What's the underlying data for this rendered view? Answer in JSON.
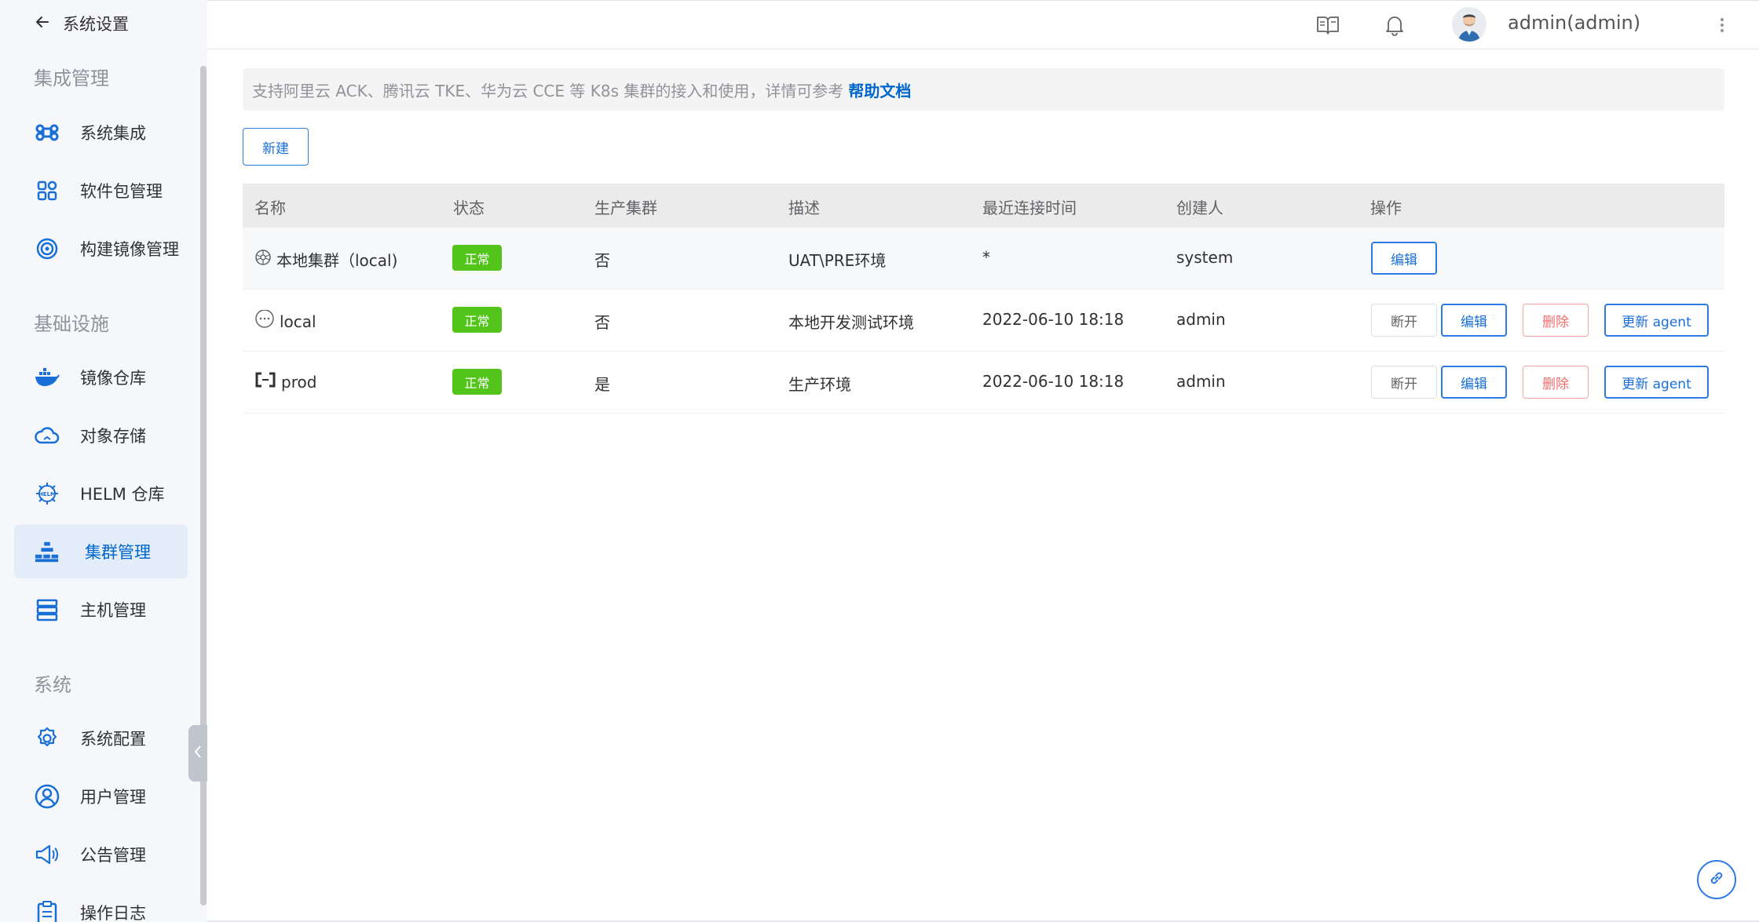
{
  "sidebar": {
    "back_label": "系统设置",
    "sections": [
      {
        "title": "集成管理"
      },
      {
        "title": "基础设施"
      },
      {
        "title": "系统"
      }
    ],
    "items": [
      {
        "label": "系统集成",
        "icon": "command-icon"
      },
      {
        "label": "软件包管理",
        "icon": "grid-icon"
      },
      {
        "label": "构建镜像管理",
        "icon": "target-icon"
      },
      {
        "label": "镜像仓库",
        "icon": "docker-icon"
      },
      {
        "label": "对象存储",
        "icon": "cloud-icon"
      },
      {
        "label": "HELM 仓库",
        "icon": "helm-icon"
      },
      {
        "label": "集群管理",
        "icon": "cluster-icon",
        "active": true
      },
      {
        "label": "主机管理",
        "icon": "server-icon"
      },
      {
        "label": "系统配置",
        "icon": "settings-icon"
      },
      {
        "label": "用户管理",
        "icon": "user-icon"
      },
      {
        "label": "公告管理",
        "icon": "megaphone-icon"
      },
      {
        "label": "操作日志",
        "icon": "clipboard-icon"
      }
    ]
  },
  "header": {
    "username": "admin(admin)"
  },
  "notice": {
    "text": "支持阿里云 ACK、腾讯云 TKE、华为云 CCE 等 K8s 集群的接入和使用，详情可参考",
    "link": "帮助文档"
  },
  "toolbar": {
    "new_label": "新建"
  },
  "table": {
    "columns": [
      "名称",
      "状态",
      "生产集群",
      "描述",
      "最近连接时间",
      "创建人",
      "操作"
    ],
    "rows": [
      {
        "name": "本地集群（local)",
        "status": "正常",
        "production": "否",
        "description": "UAT\\PRE环境",
        "last_connected": "*",
        "creator": "system",
        "actions": [
          "编辑"
        ]
      },
      {
        "name": "local",
        "status": "正常",
        "production": "否",
        "description": "本地开发测试环境",
        "last_connected": "2022-06-10 18:18",
        "creator": "admin",
        "actions": [
          "断开",
          "编辑",
          "删除",
          "更新 agent"
        ]
      },
      {
        "name": "prod",
        "status": "正常",
        "production": "是",
        "description": "生产环境",
        "last_connected": "2022-06-10 18:18",
        "creator": "admin",
        "actions": [
          "断开",
          "编辑",
          "删除",
          "更新 agent"
        ]
      }
    ]
  },
  "colors": {
    "accent": "#0066cc",
    "success": "#52c41a",
    "danger": "#f56c6c",
    "sidebar_bg": "#f5f7fa",
    "active_bg": "#e3edf9"
  }
}
